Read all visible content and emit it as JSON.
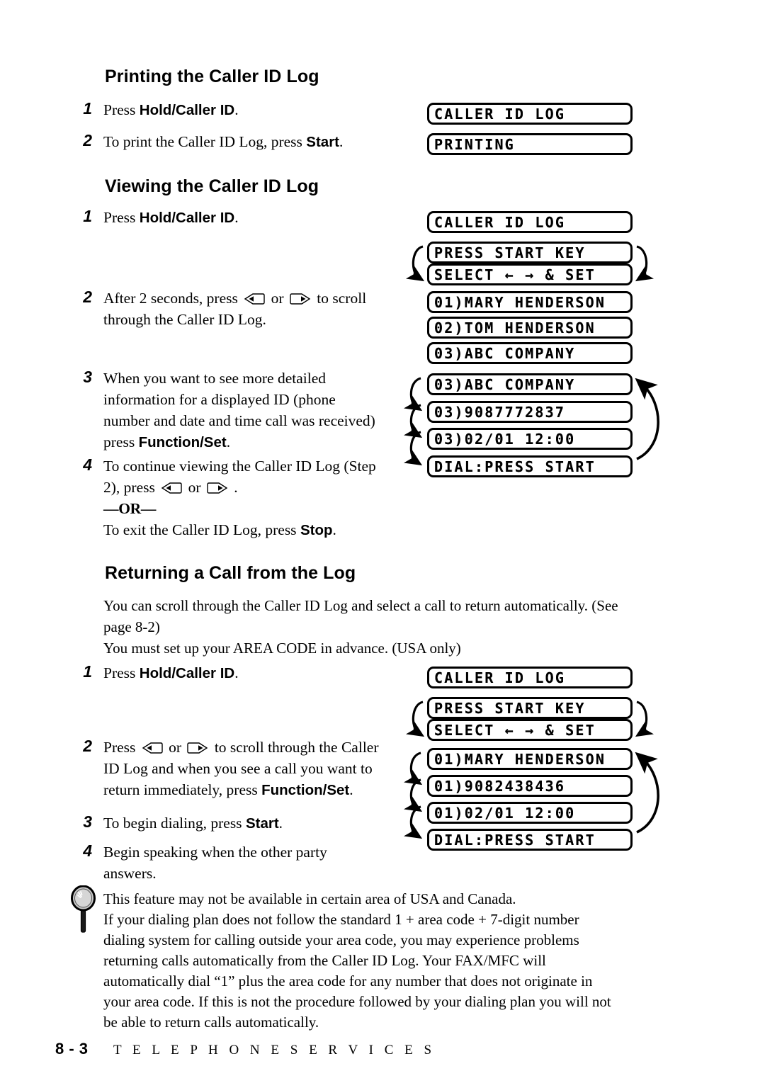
{
  "sections": {
    "printing": {
      "heading": "Printing the Caller ID Log",
      "steps": [
        {
          "num": "1",
          "pre": "Press ",
          "bold": "Hold/Caller ID",
          "post": "."
        },
        {
          "num": "2",
          "pre": "To print the Caller ID Log, press ",
          "bold": "Start",
          "post": "."
        }
      ],
      "lcd": [
        "CALLER ID LOG",
        "PRINTING"
      ]
    },
    "viewing": {
      "heading": "Viewing the Caller ID Log",
      "step1": {
        "num": "1",
        "pre": "Press ",
        "bold": "Hold/Caller ID",
        "post": "."
      },
      "step2": {
        "num": "2",
        "part1": "After 2 seconds, press",
        "or": "or",
        "part2": "to scroll",
        "line2": "through the Caller ID Log."
      },
      "step3": {
        "num": "3",
        "line1": "When you want to see more detailed",
        "line2": "information for a displayed ID (phone",
        "line3": "number and date and time call was received)",
        "line4pre": "press ",
        "line4bold": "Function/Set",
        "line4post": "."
      },
      "step4": {
        "num": "4",
        "line1": "To continue viewing the Caller ID Log (Step",
        "line2pre": "2), press",
        "or": "or",
        "line2post": ".",
        "orline": "—OR—",
        "line3pre": "To exit the Caller ID Log, press ",
        "line3bold": "Stop",
        "line3post": "."
      },
      "lcd": [
        "CALLER ID LOG",
        "PRESS START KEY",
        "SELECT ← → & SET",
        "01)MARY HENDERSON",
        "02)TOM HENDERSON",
        "03)ABC COMPANY",
        "03)ABC COMPANY",
        "03)9087772837",
        "03)02/01 12:00",
        "DIAL:PRESS START"
      ]
    },
    "returning": {
      "heading": "Returning a Call from the Log",
      "intro_line1": "You can scroll through the Caller ID Log and select a call to return automatically.  (See",
      "intro_line2": "page 8-2)",
      "intro_line3": "You must set up your AREA CODE in advance. (USA only)",
      "step1": {
        "num": "1",
        "pre": "Press ",
        "bold": "Hold/Caller ID",
        "post": "."
      },
      "step2": {
        "num": "2",
        "part1": "Press",
        "or": "or",
        "part2": "to scroll through the Caller",
        "line2": "ID Log and when you see a call you want to",
        "line3pre": "return immediately, press ",
        "line3bold": "Function/Set",
        "line3post": "."
      },
      "step3": {
        "num": "3",
        "pre": "To begin dialing, press ",
        "bold": "Start",
        "post": "."
      },
      "step4": {
        "num": "4",
        "line1": "Begin speaking when the other party",
        "line2": "answers."
      },
      "lcd": [
        "CALLER ID LOG",
        "PRESS START KEY",
        "SELECT ← → & SET",
        "01)MARY HENDERSON",
        "01)9082438436",
        "01)02/01 12:00",
        "DIAL:PRESS START"
      ]
    }
  },
  "note": {
    "icon": "magnifier-icon",
    "lines": [
      "This feature may not be available in certain area of USA and Canada.",
      "If your dialing plan does not follow the standard 1 + area code + 7-digit number",
      "dialing system for calling outside your area code, you may experience problems",
      "returning calls automatically from the Caller ID Log. Your FAX/MFC will",
      "automatically dial “1” plus the area code for any number that does not originate in",
      "your area code. If this is not the procedure followed by your dialing plan you will not",
      "be able to return calls automatically."
    ]
  },
  "footer": {
    "page_number": "8 - 3",
    "section_title": "T E L E P H O N E    S E R V I C E S"
  },
  "icons": {
    "left_arrow_key": "left-arrow-key-icon",
    "right_arrow_key": "right-arrow-key-icon"
  }
}
